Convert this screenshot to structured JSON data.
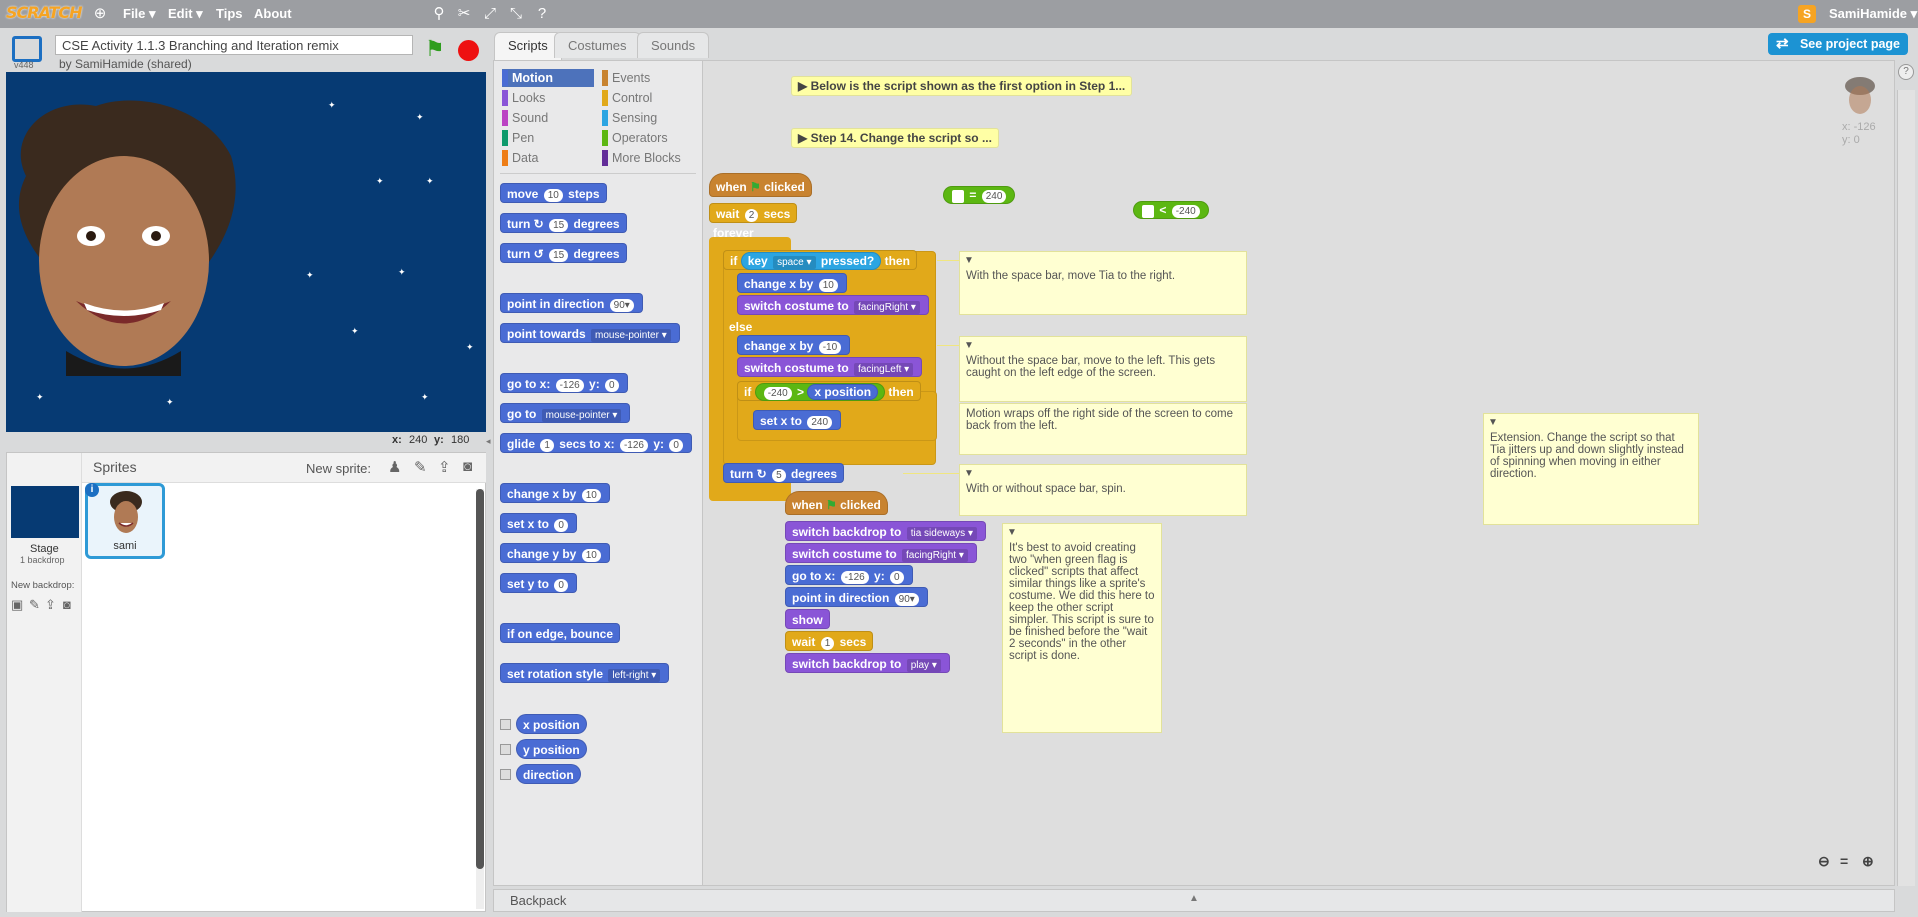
{
  "topbar": {
    "logo": "SCRATCH",
    "menus": [
      "File ▾",
      "Edit ▾",
      "Tips",
      "About"
    ],
    "user": "SamiHamide ▾",
    "icons": [
      "globe-icon",
      "duplicate-icon",
      "cut-icon",
      "grow-icon",
      "shrink-icon",
      "help-icon"
    ]
  },
  "project": {
    "title": "CSE Activity 1.1.3 Branching and Iteration remix",
    "byline": "by SamiHamide (shared)",
    "version": "v448",
    "see_project_page": "See project page"
  },
  "stage": {
    "coords_label_x": "x:",
    "coords_x": "240",
    "coords_label_y": "y:",
    "coords_y": "180"
  },
  "sprites_pane": {
    "title": "Sprites",
    "new_sprite_label": "New sprite:",
    "stage_label": "Stage",
    "stage_backdrops": "1 backdrop",
    "new_backdrop_label": "New backdrop:",
    "sprite_name": "sami"
  },
  "tabs": [
    "Scripts",
    "Costumes",
    "Sounds"
  ],
  "categories": [
    {
      "name": "Motion",
      "color": "#4a6cd4"
    },
    {
      "name": "Looks",
      "color": "#8a55d7"
    },
    {
      "name": "Sound",
      "color": "#bb42c3"
    },
    {
      "name": "Pen",
      "color": "#0e9a6c"
    },
    {
      "name": "Data",
      "color": "#ee7d16"
    },
    {
      "name": "Events",
      "color": "#c88330"
    },
    {
      "name": "Control",
      "color": "#e1a91a"
    },
    {
      "name": "Sensing",
      "color": "#2ca5e2"
    },
    {
      "name": "Operators",
      "color": "#5cb712"
    },
    {
      "name": "More Blocks",
      "color": "#632d99"
    }
  ],
  "palette": {
    "move": "move",
    "move_val": "10",
    "steps": "steps",
    "turn": "turn",
    "turn_val": "15",
    "degrees": "degrees",
    "point_dir": "point in direction",
    "point_dir_val": "90▾",
    "point_towards": "point towards",
    "point_towards_val": "mouse-pointer ▾",
    "goto": "go to x:",
    "goto_x": "-126",
    "y_label": "y:",
    "goto_y": "0",
    "goto2": "go to",
    "goto2_val": "mouse-pointer ▾",
    "glide": "glide",
    "glide_secs": "1",
    "secs_to_x": "secs to x:",
    "glide_x": "-126",
    "glide_y": "0",
    "change_x": "change x by",
    "change_x_val": "10",
    "set_x": "set x to",
    "set_x_val": "0",
    "change_y": "change y by",
    "change_y_val": "10",
    "set_y": "set y to",
    "set_y_val": "0",
    "bounce": "if on edge, bounce",
    "rotation": "set rotation style",
    "rotation_val": "left-right ▾",
    "x_position": "x position",
    "y_position": "y position",
    "direction": "direction"
  },
  "script1": {
    "when": "when",
    "clicked": "clicked",
    "wait": "wait",
    "wait_val": "2",
    "secs": "secs",
    "forever": "forever",
    "if": "if",
    "key": "key",
    "key_val": "space ▾",
    "pressed": "pressed?",
    "then": "then",
    "change_x": "change x by",
    "change_x_val1": "10",
    "switch_costume": "switch costume to",
    "costume_right": "facingRight ▾",
    "else": "else",
    "change_x_val2": "-10",
    "costume_left": "facingLeft ▾",
    "if2": "if",
    "cmp_val": "-240",
    "gt": ">",
    "x_position": "x position",
    "then2": "then",
    "set_x": "set x to",
    "set_x_val": "240",
    "turn": "turn",
    "turn_val": "5",
    "degrees": "degrees"
  },
  "script2": {
    "when": "when",
    "clicked": "clicked",
    "switch_backdrop": "switch backdrop to",
    "backdrop_val": "tia sideways ▾",
    "switch_costume": "switch costume to",
    "costume_val": "facingRight ▾",
    "goto": "go to x:",
    "goto_x": "-126",
    "y_label": "y:",
    "goto_y": "0",
    "point_dir": "point in direction",
    "point_dir_val": "90▾",
    "show": "show",
    "wait": "wait",
    "wait_val": "1",
    "secs": "secs",
    "switch_backdrop2": "switch backdrop to",
    "backdrop_val2": "play ▾"
  },
  "loose_blocks": {
    "eq": "=",
    "eq_val": "240",
    "lt": "<",
    "lt_val": "-240"
  },
  "comments": {
    "collapsed1": "Below is the script shown as the first option in Step 1...",
    "collapsed2": "Step 14. Change the script so ...",
    "c_space": "With the space bar, move Tia to the right.",
    "c_nospace": "Without the space bar, move to the left. This gets caught on the left edge of the screen.",
    "c_wrap": "Motion wraps off the right side of the screen to come back from the left.",
    "c_spin": "With or without space bar, spin.",
    "c_best": "It's best to avoid creating two \"when green flag is clicked\" scripts that affect similar things like a sprite's costume. We did this here to keep the other script simpler. This script is sure to be finished before the \"wait 2 seconds\" in the other script is done.",
    "c_ext": "Extension. Change the script so that Tia jitters up and down slightly instead of spinning when moving in either direction."
  },
  "sprite_info": {
    "x": "x: -126",
    "y": "y: 0"
  },
  "backpack": "Backpack"
}
